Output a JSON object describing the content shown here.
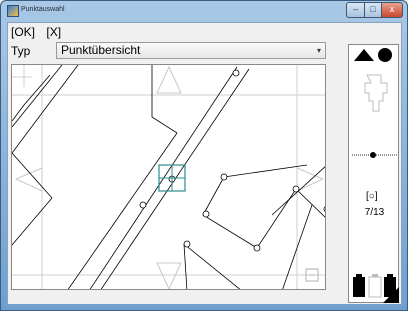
{
  "window": {
    "title": "Punktauswahl",
    "min_label": "‒",
    "max_label": "□",
    "close_label": "x"
  },
  "menu": {
    "ok": "[OK]",
    "cancel": "[X]"
  },
  "type": {
    "label": "Typ",
    "selected": "Punktübersicht"
  },
  "sidepanel": {
    "counter": "7/13",
    "counter_icon": "[○]"
  },
  "icons": {
    "app": "app-icon",
    "triangle_circle": "triangle-circle-icon",
    "pan": "pan-icon",
    "zoom_slider": "zoom-slider-icon",
    "points": "points-icon",
    "battery": "battery-icon",
    "corner": "corner-icon"
  },
  "colors": {
    "title_gradient_top": "#a9c8e6",
    "title_gradient_bottom": "#6f9fcf",
    "close_red": "#c8472f",
    "selection_teal": "#2c8c8c"
  }
}
